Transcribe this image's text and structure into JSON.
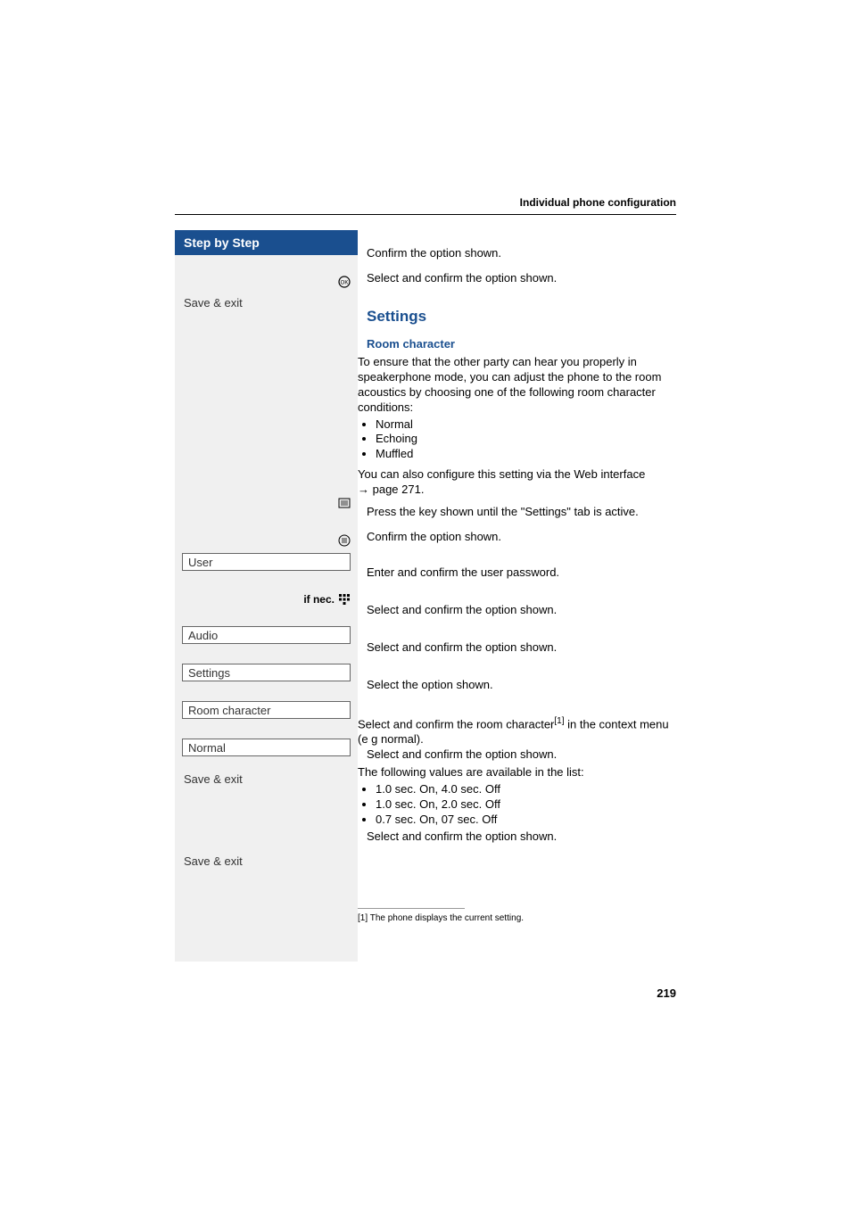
{
  "header": {
    "title": "Individual phone configuration"
  },
  "sidebar": {
    "step_header": "Step by Step",
    "items": {
      "save_exit_1": "Save & exit",
      "user": "User",
      "if_nec": "if nec.",
      "audio": "Audio",
      "settings": "Settings",
      "room_character": "Room character",
      "normal": "Normal",
      "save_exit_2": "Save & exit",
      "save_exit_3": "Save & exit"
    },
    "icons": {
      "ok": "ok-icon",
      "web": "web-icon",
      "settings_key": "settings-key-icon",
      "keypad": "keypad-icon"
    }
  },
  "main": {
    "confirm_option": "Confirm the option shown.",
    "select_confirm": "Select and confirm the option shown.",
    "settings_heading": "Settings",
    "room_character_heading": "Room character",
    "room_intro": "To ensure that the other party can hear you properly in speakerphone mode, you can adjust the phone to the room acoustics by choosing one of the following room character conditions:",
    "room_options": [
      "Normal",
      "Echoing",
      "Muffled"
    ],
    "web_interface_1": "You can also configure this setting via the Web interface ",
    "web_interface_2": " page 271.",
    "press_key": "Press the key shown until the \"Settings\" tab is active.",
    "enter_password": "Enter and confirm the user password.",
    "select_option": "Select the option shown.",
    "select_room_character_1": "Select and confirm the room character",
    "select_room_character_sup": "[1]",
    "select_room_character_2": " in the context menu (e g normal).",
    "values_intro": "The following values are available in the list:",
    "values": [
      "1.0 sec. On, 4.0 sec. Off",
      "1.0 sec. On, 2.0 sec. Off",
      "0.7 sec. On, 07 sec. Off"
    ],
    "footnote": "[1] The phone displays the current setting."
  },
  "page_number": "219"
}
